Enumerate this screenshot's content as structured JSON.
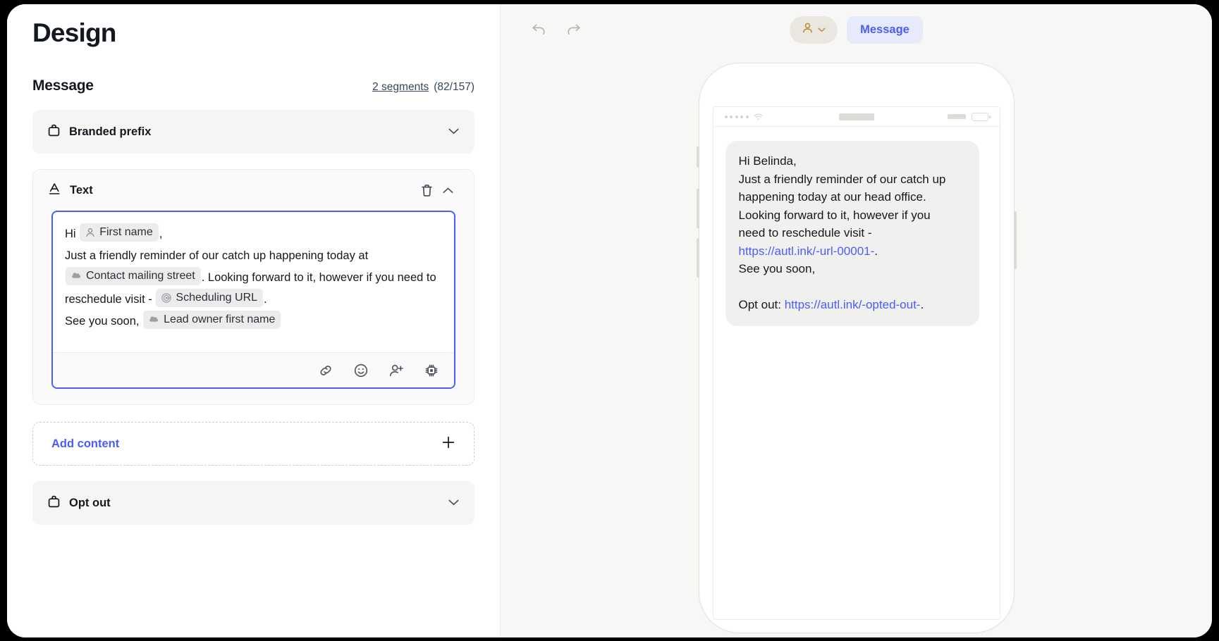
{
  "page": {
    "title": "Design"
  },
  "message_section": {
    "label": "Message",
    "segments_link": "2 segments",
    "char_count": "(82/157)"
  },
  "blocks": {
    "branded_prefix": {
      "title": "Branded prefix",
      "icon": "briefcase-icon",
      "chevron": "chevron-down-icon"
    },
    "text": {
      "title": "Text",
      "icon": "text-format-icon",
      "delete_icon": "trash-icon",
      "chevron": "chevron-up-icon"
    },
    "opt_out": {
      "title": "Opt out",
      "icon": "briefcase-icon",
      "chevron": "chevron-down-icon"
    }
  },
  "editor": {
    "line1_prefix": "Hi",
    "token_first_name": "First name",
    "line1_suffix": ",",
    "line2": "Just a friendly reminder of our catch up happening today at",
    "token_mailing_street": "Contact mailing street",
    "line3_mid": ". Looking forward to it, however if you need to reschedule visit -",
    "token_scheduling_url": "Scheduling URL",
    "line3_end": ".",
    "line4": "See you soon,",
    "token_lead_owner": "Lead owner first name",
    "toolbar": {
      "link": "link-icon",
      "emoji": "emoji-icon",
      "personalize": "add-person-icon",
      "ai": "ai-chip-icon"
    }
  },
  "add_content": {
    "label": "Add content",
    "icon": "plus-icon"
  },
  "preview_toolbar": {
    "undo": "undo-icon",
    "redo": "redo-icon",
    "persona_icon": "person-icon",
    "persona_chevron": "chevron-down-icon",
    "message_tab": "Message"
  },
  "phone_preview": {
    "status_bar": {
      "signal": "signal-dots-icon",
      "wifi": "wifi-icon",
      "time_placeholder": "",
      "carrier_placeholder": "",
      "battery": "battery-icon"
    },
    "bubble": {
      "line1": "Hi Belinda,",
      "line2": "Just a friendly reminder of our catch up",
      "line3": "happening today at our head office.",
      "line4": "Looking forward to it, however if you",
      "line5": "need to reschedule visit -",
      "link1": "https://autl.ink/-url-00001-",
      "line5_end": ".",
      "line6": "See you soon,",
      "optout_label": "Opt out: ",
      "link2": "https://autl.ink/-opted-out-",
      "optout_end": "."
    }
  },
  "colors": {
    "accent_blue": "#4a5df9",
    "bubble_bg": "#f0f0ef",
    "card_bg": "#f5f5f3",
    "persona_bg": "#eae7e0",
    "persona_icon": "#c28b37"
  }
}
